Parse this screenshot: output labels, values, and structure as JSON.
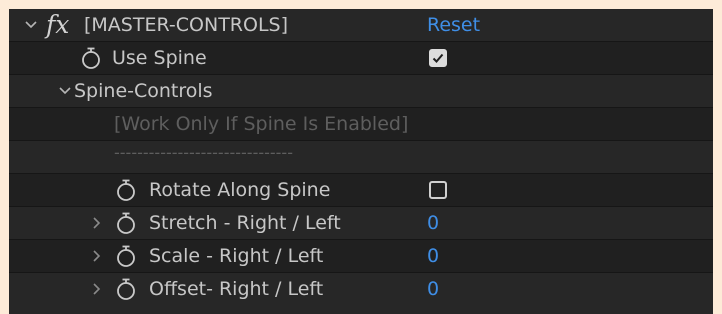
{
  "effect": {
    "name": "[MASTER-CONTROLS]",
    "reset_label": "Reset"
  },
  "params": {
    "use_spine": {
      "label": "Use Spine",
      "checked": true
    },
    "spine_group": {
      "label": "Spine-Controls"
    },
    "note": "[Work Only If Spine Is Enabled]",
    "separator": "-------------------------------",
    "rotate_along_spine": {
      "label": "Rotate Along Spine",
      "checked": false
    },
    "stretch": {
      "label": "Stretch - Right / Left",
      "value": "0"
    },
    "scale": {
      "label": "Scale - Right / Left",
      "value": "0"
    },
    "offset": {
      "label": "Offset- Right / Left",
      "value": "0"
    }
  },
  "colors": {
    "value_blue": "#3f8ee6",
    "panel_bg": "#1e1e1e",
    "outer_bg": "#fdebd8"
  },
  "icons": {
    "expand_open": "chevron-down-icon",
    "expand_closed": "chevron-right-icon",
    "keyframe": "stopwatch-icon",
    "effect": "fx-icon"
  }
}
